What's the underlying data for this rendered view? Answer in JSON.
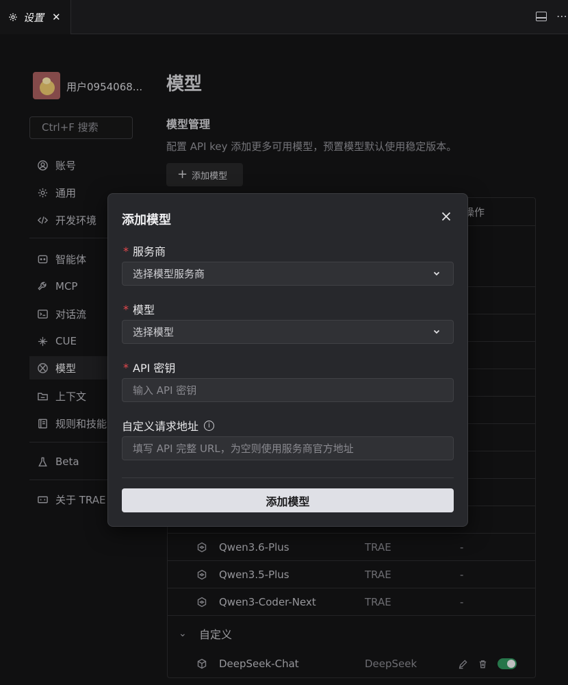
{
  "tab": {
    "title": "设置",
    "close": "✕"
  },
  "toolbar": {
    "more": "⋯"
  },
  "sidebar": {
    "username": "用户0954068...",
    "search_placeholder": "Ctrl+F 搜索",
    "items": [
      {
        "label": "账号",
        "icon": "user-icon"
      },
      {
        "label": "通用",
        "icon": "gear-icon"
      },
      {
        "label": "开发环境",
        "icon": "code-icon"
      },
      {
        "label": "智能体",
        "icon": "bot-icon"
      },
      {
        "label": "MCP",
        "icon": "wrench-icon"
      },
      {
        "label": "对话流",
        "icon": "terminal-icon"
      },
      {
        "label": "CUE",
        "icon": "cue-icon"
      },
      {
        "label": "模型",
        "icon": "model-icon"
      },
      {
        "label": "上下文",
        "icon": "folder-icon"
      },
      {
        "label": "规则和技能",
        "icon": "book-icon"
      },
      {
        "label": "Beta",
        "icon": "flask-icon"
      },
      {
        "label": "关于 TRAE",
        "icon": "trae-icon"
      }
    ]
  },
  "main": {
    "title": "模型",
    "section_title": "模型管理",
    "section_desc": "配置 API key 添加更多可用模型，预置模型默认使用稳定版本。",
    "add_button": "添加模型",
    "table": {
      "col_ops": "操作",
      "rows": [
        {
          "name": "Qwen3.6-Plus",
          "provider": "TRAE",
          "ops": "-"
        },
        {
          "name": "Qwen3.5-Plus",
          "provider": "TRAE",
          "ops": "-"
        },
        {
          "name": "Qwen3-Coder-Next",
          "provider": "TRAE",
          "ops": "-"
        }
      ],
      "custom_group": "自定义",
      "custom_rows": [
        {
          "name": "DeepSeek-Chat",
          "provider": "DeepSeek",
          "enabled": true
        }
      ]
    }
  },
  "modal": {
    "title": "添加模型",
    "provider_label": "服务商",
    "provider_value": "选择模型服务商",
    "model_label": "模型",
    "model_value": "选择模型",
    "apikey_label": "API 密钥",
    "apikey_placeholder": "输入 API 密钥",
    "url_label": "自定义请求地址",
    "url_placeholder": "填写 API 完整 URL，为空则使用服务商官方地址",
    "required_mark": "*",
    "submit": "添加模型"
  }
}
